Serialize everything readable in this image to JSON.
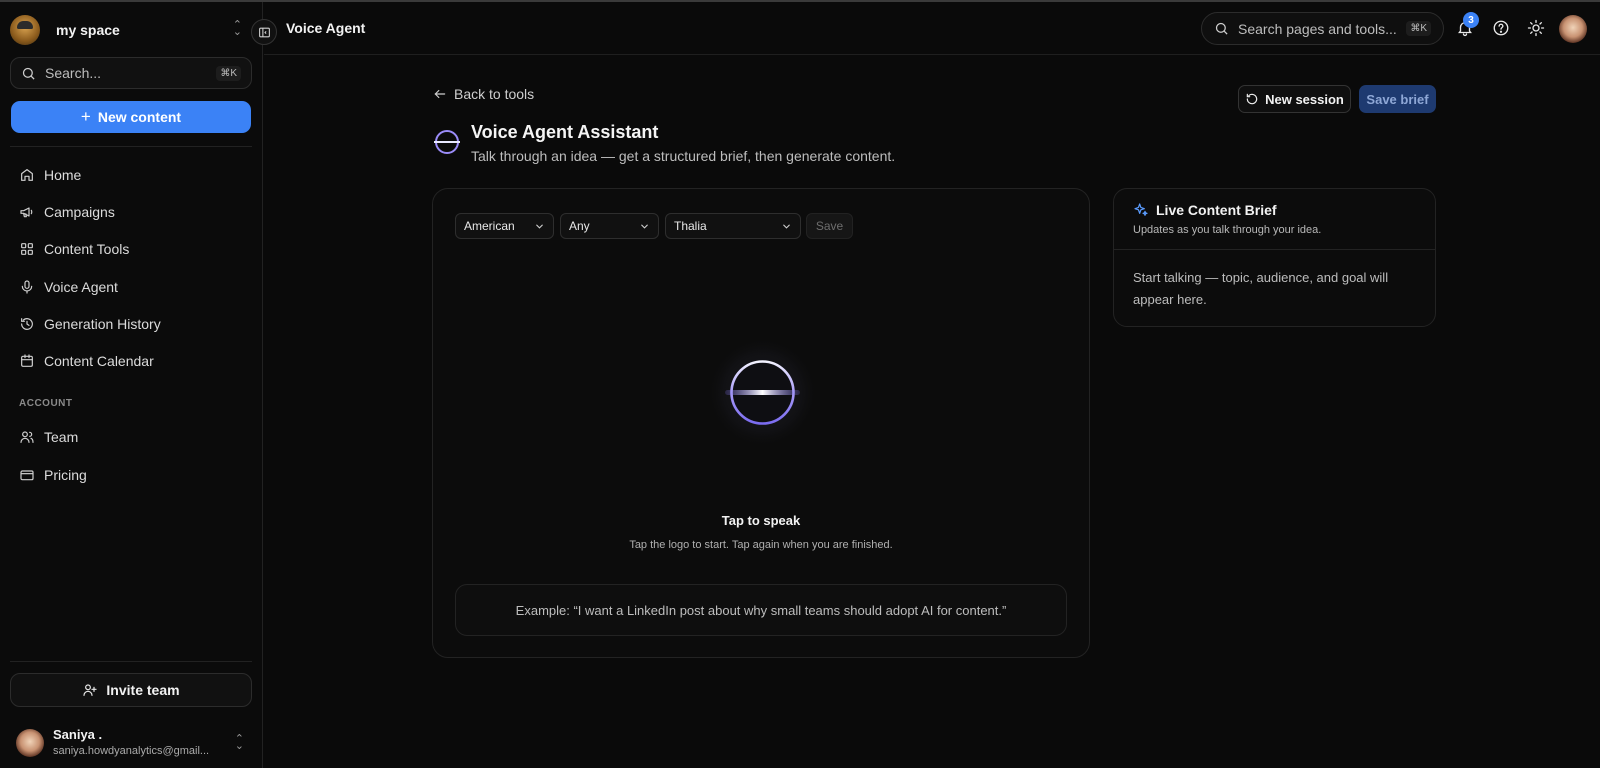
{
  "workspace": {
    "name": "my space"
  },
  "sidebar": {
    "search": {
      "placeholder": "Search...",
      "shortcut": "⌘K"
    },
    "new_content_label": "New content",
    "items": [
      {
        "label": "Home",
        "icon": "home-icon"
      },
      {
        "label": "Campaigns",
        "icon": "megaphone-icon"
      },
      {
        "label": "Content Tools",
        "icon": "grid-icon"
      },
      {
        "label": "Voice Agent",
        "icon": "microphone-icon"
      },
      {
        "label": "Generation History",
        "icon": "history-icon"
      },
      {
        "label": "Content Calendar",
        "icon": "calendar-icon"
      }
    ],
    "account_label": "ACCOUNT",
    "account_items": [
      {
        "label": "Team",
        "icon": "users-icon"
      },
      {
        "label": "Pricing",
        "icon": "credit-card-icon"
      }
    ],
    "invite_label": "Invite team",
    "user": {
      "name": "Saniya .",
      "email": "saniya.howdyanalytics@gmail..."
    }
  },
  "header": {
    "title": "Voice Agent",
    "search": {
      "placeholder": "Search pages and tools...",
      "shortcut": "⌘K"
    },
    "notification_count": "3"
  },
  "main": {
    "back_label": "Back to tools",
    "new_session_label": "New session",
    "save_brief_label": "Save brief",
    "title": "Voice Agent Assistant",
    "subtitle": "Talk through an idea — get a structured brief, then generate content.",
    "selects": {
      "accent": "American",
      "age": "Any",
      "voice": "Thalia"
    },
    "save_label": "Save",
    "tap_title": "Tap to speak",
    "tap_subtitle": "Tap the logo to start. Tap again when you are finished.",
    "example": "Example: “I want a LinkedIn post about why small teams should adopt AI for content.”"
  },
  "brief": {
    "title": "Live Content Brief",
    "subtitle": "Updates as you talk through your idea.",
    "body": "Start talking — topic, audience, and goal will appear here."
  },
  "colors": {
    "accent": "#3b82f6",
    "background": "#0a0a0a",
    "orb_ring": "#8b7cf6"
  }
}
